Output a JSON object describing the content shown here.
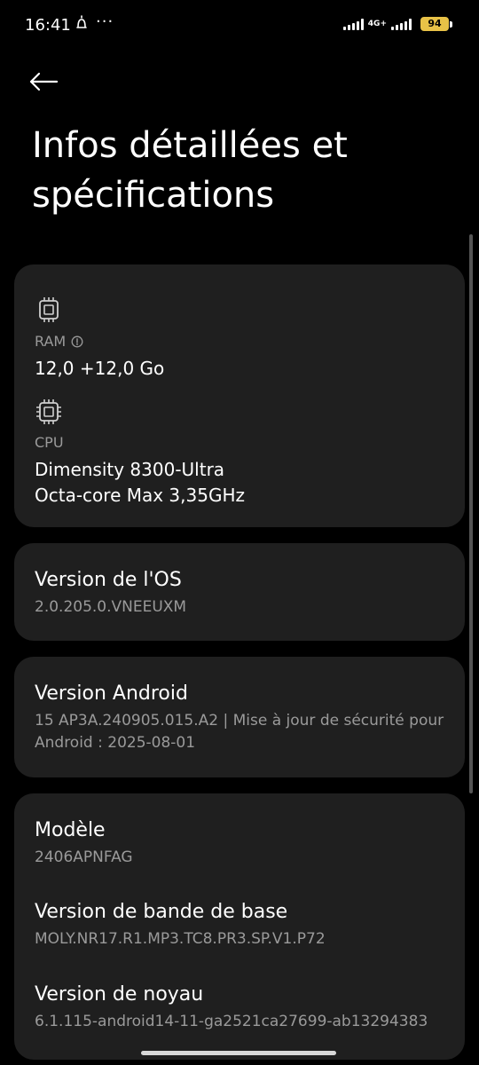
{
  "status_bar": {
    "time": "16:41",
    "alarm_icon": "alarm-bell-icon",
    "more_icon": "···",
    "network": "4G+",
    "battery": "94",
    "battery_color": "#e8c247"
  },
  "header": {
    "back_icon": "back-arrow-icon",
    "title": "Infos détaillées et spécifications"
  },
  "ram_card": {
    "ram_icon": "memory-chip-icon",
    "ram_label": "RAM",
    "ram_info_icon": "info-icon",
    "ram_value": "12,0 +12,0 Go",
    "cpu_icon": "cpu-chip-icon",
    "cpu_label": "CPU",
    "cpu_value_line1": "Dimensity 8300-Ultra",
    "cpu_value_line2": "Octa-core Max 3,35GHz"
  },
  "os_card": {
    "title": "Version de l'OS",
    "value": "2.0.205.0.VNEEUXM"
  },
  "android_card": {
    "title": "Version Android",
    "value": "15 AP3A.240905.015.A2 | Mise à jour de sécurité pour Android : 2025-08-01"
  },
  "model_card": {
    "model_title": "Modèle",
    "model_value": "2406APNFAG",
    "baseband_title": "Version de bande de base",
    "baseband_value": "MOLY.NR17.R1.MP3.TC8.PR3.SP.V1.P72",
    "kernel_title": "Version de noyau",
    "kernel_value": "6.1.115-android14-11-ga2521ca27699-ab13294383"
  },
  "colors": {
    "background": "#000000",
    "card": "#1f1f1f",
    "primary_text": "#ffffff",
    "secondary_text": "#9a9a9a"
  }
}
